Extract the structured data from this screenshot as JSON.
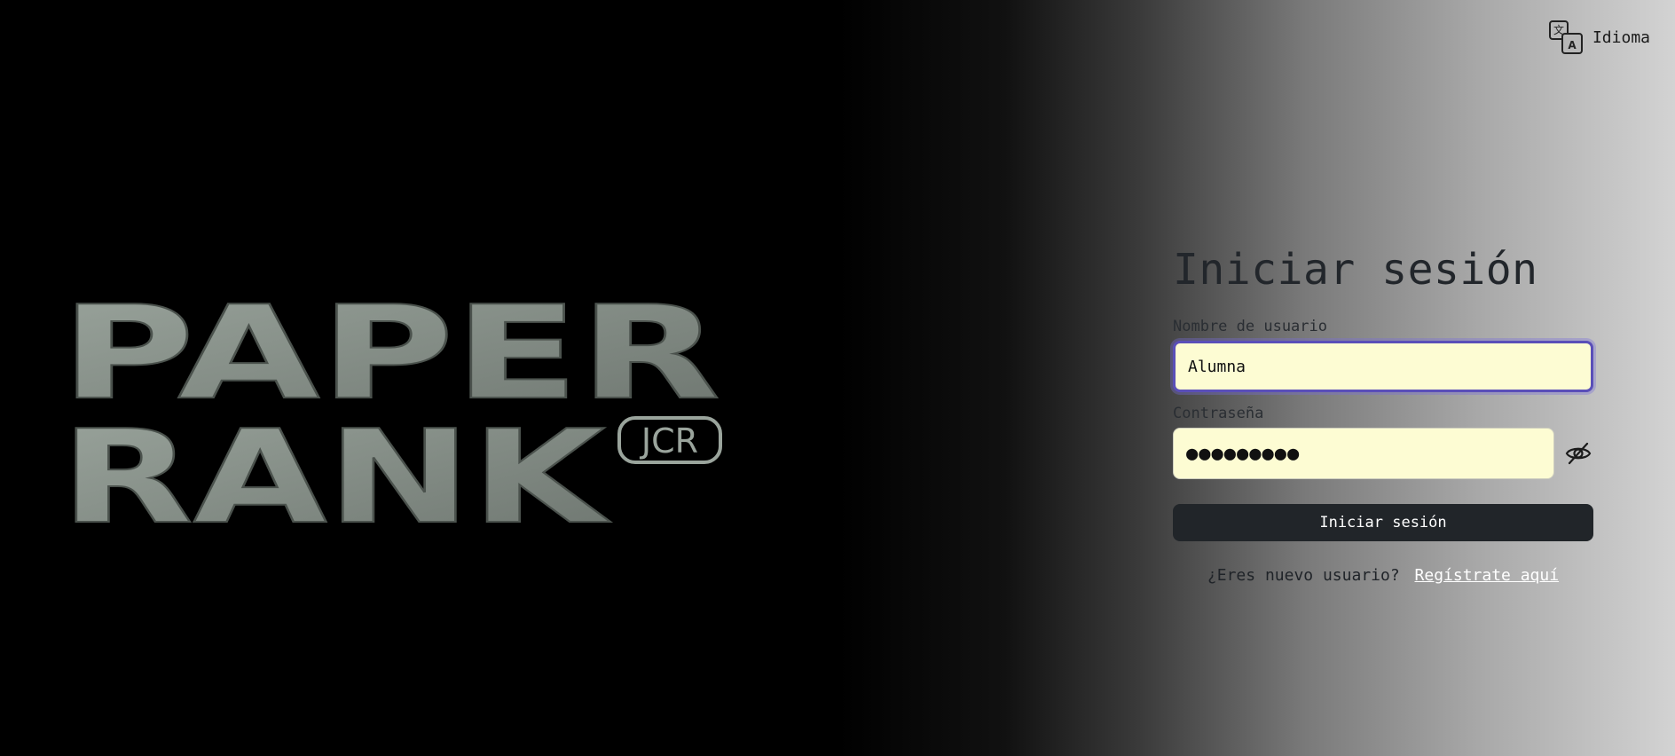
{
  "header": {
    "language_label": "Idioma",
    "language_icon": "translate-icon"
  },
  "logo": {
    "line1": "PAPER",
    "line2": "RANK",
    "badge": "JCR"
  },
  "login": {
    "title": "Iniciar sesión",
    "username_label": "Nombre de usuario",
    "username_value": "Alumna",
    "password_label": "Contraseña",
    "password_value": "●●●●●●●●●",
    "password_toggle_icon": "eye-slash-icon",
    "submit_label": "Iniciar sesión",
    "register_prompt": "¿Eres nuevo usuario?",
    "register_link": "Regístrate aquí"
  },
  "colors": {
    "input_bg": "#fdfcd3",
    "focus_ring": "#5a4fb8",
    "button_bg": "#212529",
    "logo_fill": "#8a938c"
  }
}
